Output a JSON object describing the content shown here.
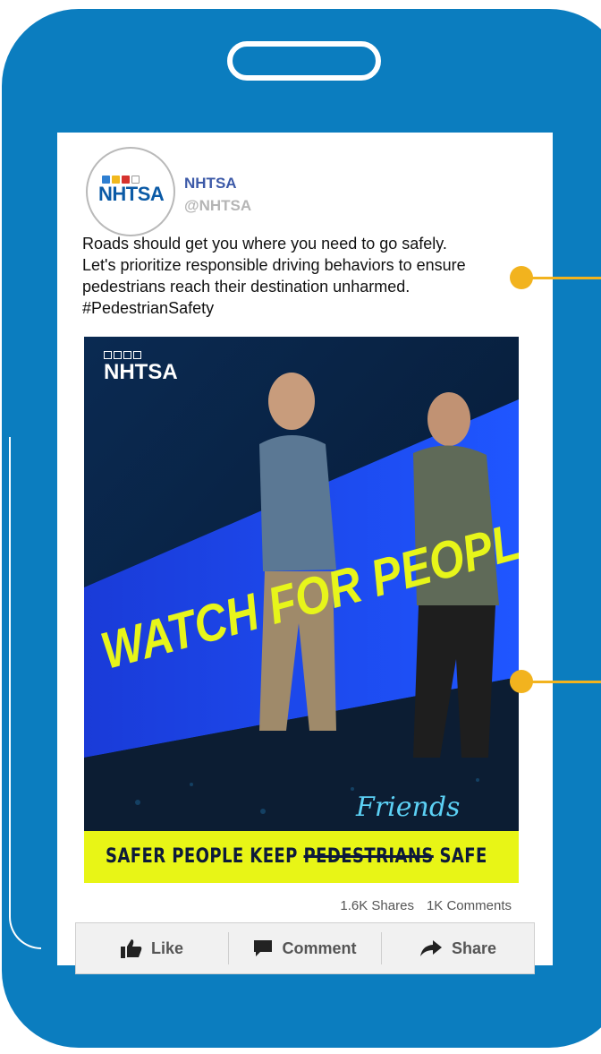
{
  "account": {
    "name": "NHTSA",
    "handle": "@NHTSA",
    "avatar_logo": "NHTSA"
  },
  "post": {
    "text": "Roads should get you where you need to go safely. Let's prioritize responsible driving behaviors to ensure pedestrians reach their destination unharmed. #PedestrianSafety"
  },
  "image": {
    "logo": "NHTSA",
    "headline": "WATCH FOR PEOPLE",
    "annotation": "Friends",
    "tagline_before": "SAFER PEOPLE KEEP ",
    "tagline_struck": "PEDESTRIANS",
    "tagline_after": " SAFE"
  },
  "stats": {
    "shares": "1.6K Shares",
    "comments": "1K Comments"
  },
  "actions": [
    {
      "label": "Like",
      "icon": "thumbs-up-icon"
    },
    {
      "label": "Comment",
      "icon": "comment-icon"
    },
    {
      "label": "Share",
      "icon": "share-icon"
    }
  ],
  "colors": {
    "phone": "#0b7dbf",
    "accent_yellow": "#e8f516",
    "connector": "#f2b31e",
    "account_name": "#3d5aa8"
  }
}
